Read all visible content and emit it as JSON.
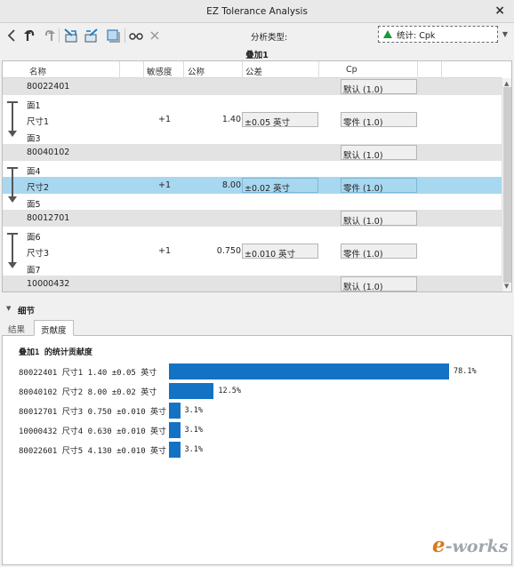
{
  "window": {
    "title": "EZ Tolerance Analysis",
    "close_glyph": "×"
  },
  "toolbar": {
    "analysis_type_label": "分析类型:",
    "statistic_value": "统计: Cpk",
    "group_label": "叠加1",
    "icons": [
      "back-icon",
      "undo-icon",
      "redo-icon",
      "stack-left-icon",
      "stack-right-icon",
      "panel-icon",
      "glasses-icon",
      "close-icon"
    ]
  },
  "grid": {
    "headers": {
      "name": "名称",
      "sensitivity": "敏感度",
      "nominal": "公称",
      "tolerance": "公差",
      "cp": "Cp"
    },
    "rows": [
      {
        "kind": "part",
        "name": "80022401",
        "cp": "默认 (1.0)"
      },
      {
        "kind": "face",
        "name": "面1"
      },
      {
        "kind": "dim",
        "name": "尺寸1",
        "sensitivity": "+1",
        "nominal": "1.40",
        "tolerance": "±0.05 英寸",
        "cp": "零件 (1.0)"
      },
      {
        "kind": "face",
        "name": "面3"
      },
      {
        "kind": "part",
        "name": "80040102",
        "cp": "默认 (1.0)"
      },
      {
        "kind": "face",
        "name": "面4"
      },
      {
        "kind": "dim",
        "name": "尺寸2",
        "sensitivity": "+1",
        "nominal": "8.00",
        "tolerance": "±0.02 英寸",
        "cp": "零件 (1.0)",
        "selected": true
      },
      {
        "kind": "face",
        "name": "面5"
      },
      {
        "kind": "part",
        "name": "80012701",
        "cp": "默认 (1.0)"
      },
      {
        "kind": "face",
        "name": "面6"
      },
      {
        "kind": "dim",
        "name": "尺寸3",
        "sensitivity": "+1",
        "nominal": "0.750",
        "tolerance": "±0.010 英寸",
        "cp": "零件 (1.0)"
      },
      {
        "kind": "face",
        "name": "面7"
      },
      {
        "kind": "part",
        "name": "10000432",
        "cp": "默认 (1.0)"
      }
    ]
  },
  "details": {
    "label": "细节",
    "tabs": [
      {
        "label": "结果"
      },
      {
        "label": "贡献度",
        "active": true
      }
    ]
  },
  "chart_data": {
    "type": "bar",
    "title": "叠加1 的统计贡献度",
    "orientation": "horizontal",
    "categories": [
      "80022401 尺寸1 1.40 ±0.05 英寸",
      "80040102 尺寸2 8.00 ±0.02 英寸",
      "80012701 尺寸3 0.750 ±0.010 英寸",
      "10000432 尺寸4 0.630 ±0.010 英寸",
      "80022601 尺寸5 4.130 ±0.010 英寸"
    ],
    "values": [
      78.1,
      12.5,
      3.1,
      3.1,
      3.1
    ],
    "value_labels": [
      "78.1%",
      "12.5%",
      "3.1%",
      "3.1%",
      "3.1%"
    ],
    "unit": "%",
    "bar_color": "#1472c4"
  },
  "watermark": {
    "e": "e",
    "rest": "-works"
  }
}
